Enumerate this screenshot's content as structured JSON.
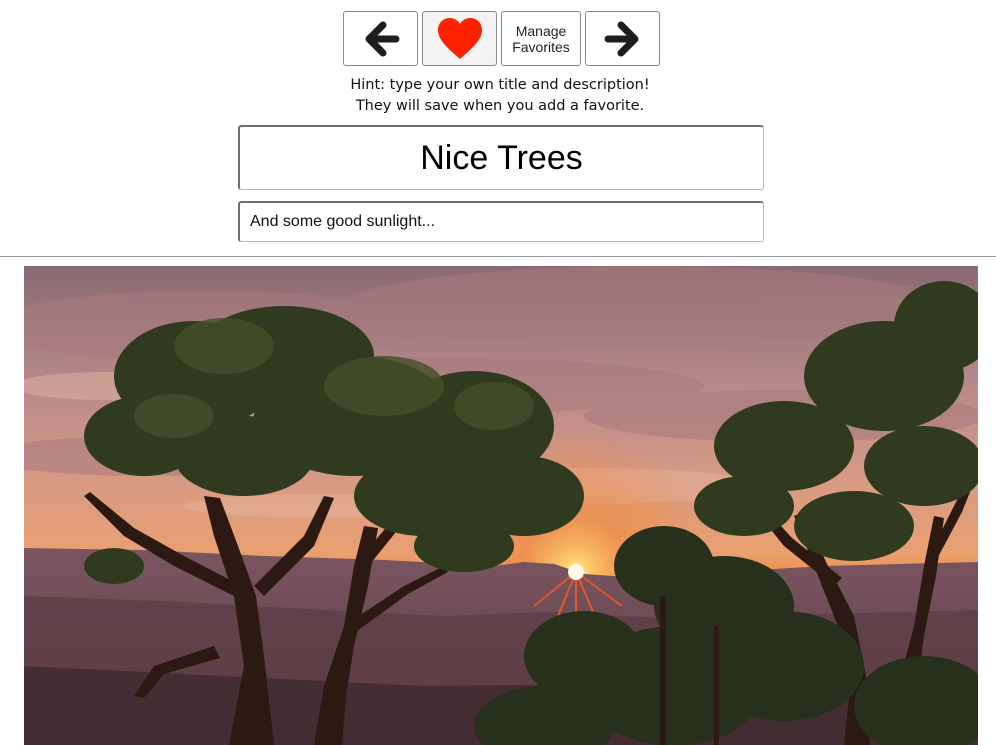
{
  "toolbar": {
    "prev_icon": "arrow-left-icon",
    "favorite_icon": "heart-icon",
    "favorite_color": "#ff2200",
    "manage_label_line1": "Manage",
    "manage_label_line2": "Favorites",
    "next_icon": "arrow-right-icon"
  },
  "hint": {
    "line1": "Hint: type your own title and description!",
    "line2": "They will save when you add a favorite."
  },
  "title_input": {
    "value": "Nice Trees"
  },
  "description_input": {
    "value": "And some good sunlight..."
  }
}
